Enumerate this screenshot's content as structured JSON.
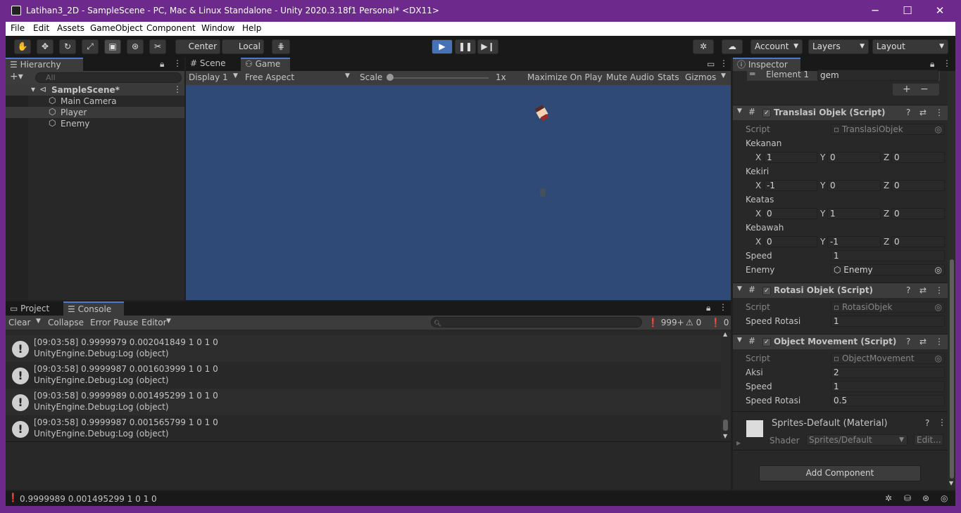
{
  "window": {
    "title": "Latihan3_2D - SampleScene - PC, Mac & Linux Standalone - Unity 2020.3.18f1 Personal* <DX11>",
    "minimize": "─",
    "maximize": "☐",
    "close": "✕"
  },
  "menu": [
    "File",
    "Edit",
    "Assets",
    "GameObject",
    "Component",
    "Window",
    "Help"
  ],
  "toolbar": {
    "center_label": "Center",
    "local_label": "Local",
    "account_label": "Account",
    "layers_label": "Layers",
    "layout_label": "Layout"
  },
  "hierarchy": {
    "tab": "Hierarchy",
    "search_placeholder": "All",
    "scene": "SampleScene*",
    "items": [
      "Main Camera",
      "Player",
      "Enemy"
    ]
  },
  "game": {
    "tabs": [
      "Scene",
      "Game"
    ],
    "display": "Display 1",
    "aspect": "Free Aspect",
    "scale_label": "Scale",
    "scale_value": "1x",
    "maximize": "Maximize On Play",
    "mute": "Mute Audio",
    "stats": "Stats",
    "gizmos": "Gizmos",
    "bg_color": "#304a78"
  },
  "console": {
    "tabs": [
      "Project",
      "Console"
    ],
    "clear": "Clear",
    "collapse": "Collapse",
    "error_pause": "Error Pause",
    "editor": "Editor",
    "count_logs": "999+",
    "count_warn": "0",
    "count_err": "0",
    "rows": [
      {
        "line1": "[09:03:58] 0.9999979 0.002041849 1 0 1 0",
        "line2": "UnityEngine.Debug:Log (object)"
      },
      {
        "line1": "[09:03:58] 0.9999987 0.001603999 1 0 1 0",
        "line2": "UnityEngine.Debug:Log (object)"
      },
      {
        "line1": "[09:03:58] 0.9999989 0.001495299 1 0 1 0",
        "line2": "UnityEngine.Debug:Log (object)"
      },
      {
        "line1": "[09:03:58] 0.9999987 0.001565799 1 0 1 0",
        "line2": "UnityEngine.Debug:Log (object)"
      }
    ]
  },
  "status": {
    "text": "0.9999989 0.001495299 1 0 1 0"
  },
  "inspector": {
    "tab": "Inspector",
    "element1_label": "Element 1",
    "element1_value": "gem",
    "translasi": {
      "title": "Translasi Objek (Script)",
      "script_label": "Script",
      "script_value": "TranslasiObjek",
      "kekanan": "Kekanan",
      "kekanan_x": "1",
      "kekanan_y": "0",
      "kekanan_z": "0",
      "kekiri": "Kekiri",
      "kekiri_x": "-1",
      "kekiri_y": "0",
      "kekiri_z": "0",
      "keatas": "Keatas",
      "keatas_x": "0",
      "keatas_y": "1",
      "keatas_z": "0",
      "kebawah": "Kebawah",
      "kebawah_x": "0",
      "kebawah_y": "-1",
      "kebawah_z": "0",
      "speed_label": "Speed",
      "speed_value": "1",
      "enemy_label": "Enemy",
      "enemy_value": "Enemy"
    },
    "rotasi": {
      "title": "Rotasi Objek (Script)",
      "script_label": "Script",
      "script_value": "RotasiObjek",
      "speed_rot_label": "Speed Rotasi",
      "speed_rot_value": "1"
    },
    "movement": {
      "title": "Object Movement (Script)",
      "script_label": "Script",
      "script_value": "ObjectMovement",
      "aksi_label": "Aksi",
      "aksi_value": "2",
      "speed_label": "Speed",
      "speed_value": "1",
      "speed_rot_label": "Speed Rotasi",
      "speed_rot_value": "0.5"
    },
    "material": {
      "title": "Sprites-Default (Material)",
      "shader_label": "Shader",
      "shader_value": "Sprites/Default",
      "edit_label": "Edit..."
    },
    "add_component": "Add Component"
  },
  "axis": {
    "x": "X",
    "y": "Y",
    "z": "Z"
  }
}
